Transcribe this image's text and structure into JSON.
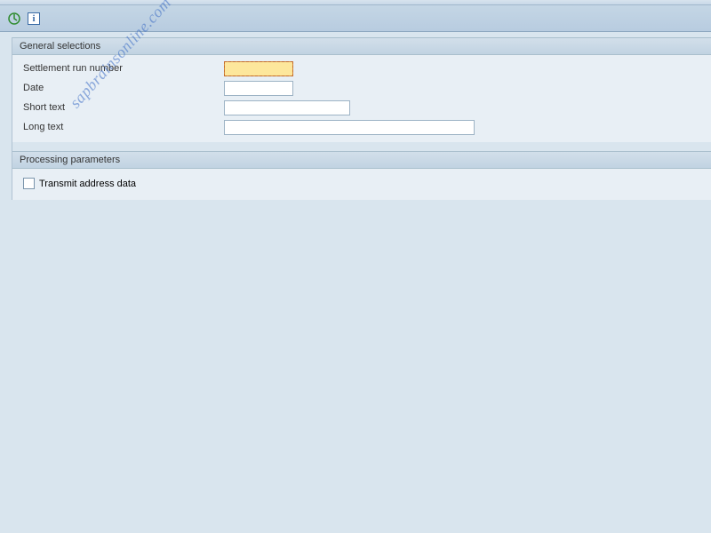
{
  "toolbar": {
    "execute_title": "Execute",
    "info_title": "Information"
  },
  "sections": {
    "general": {
      "title": "General selections",
      "fields": {
        "settlement_run": {
          "label": "Settlement run number",
          "value": ""
        },
        "date": {
          "label": "Date",
          "value": ""
        },
        "short_text": {
          "label": "Short text",
          "value": ""
        },
        "long_text": {
          "label": "Long text",
          "value": ""
        }
      }
    },
    "processing": {
      "title": "Processing parameters",
      "transmit_address": {
        "label": "Transmit address data",
        "checked": false
      }
    }
  },
  "watermark": "sapbrainsonline.com"
}
